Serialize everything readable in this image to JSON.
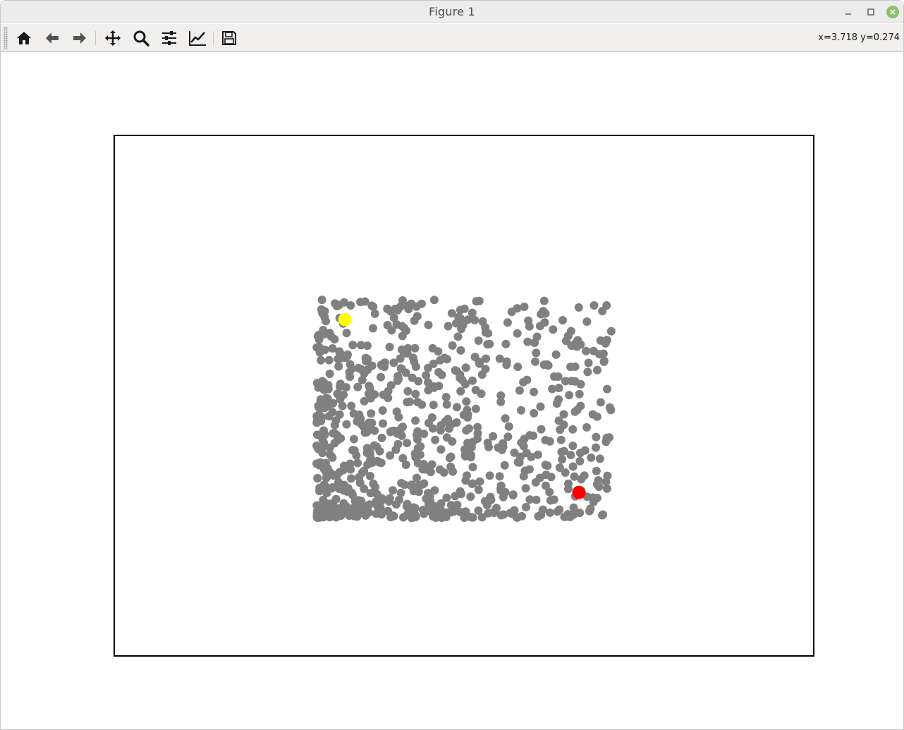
{
  "window": {
    "title": "Figure 1"
  },
  "toolbar": {
    "buttons": [
      {
        "name": "home-button",
        "icon": "home-icon"
      },
      {
        "name": "back-button",
        "icon": "arrow-left-icon"
      },
      {
        "name": "forward-button",
        "icon": "arrow-right-icon"
      },
      {
        "name": "pan-button",
        "icon": "move-icon"
      },
      {
        "name": "zoom-button",
        "icon": "magnifier-icon"
      },
      {
        "name": "configure-subplots-button",
        "icon": "sliders-icon"
      },
      {
        "name": "edit-axes-button",
        "icon": "line-chart-icon"
      },
      {
        "name": "save-button",
        "icon": "floppy-disk-icon"
      }
    ],
    "coords": "x=3.718 y=0.274"
  },
  "colors": {
    "point": "#808080",
    "yellow_marker": "#ffff00",
    "red_marker": "#ff0000",
    "close_button": "#8fbf6f",
    "axes_frame": "#000000"
  },
  "chart_data": {
    "type": "scatter",
    "axes_visible": false,
    "grid": false,
    "title": "",
    "xlabel": "",
    "ylabel": "",
    "xlim": [
      -7.5,
      9.8
    ],
    "ylim": [
      -4.5,
      5.7
    ],
    "cloud": {
      "count": 780,
      "x_range": [
        -2.5,
        4.8
      ],
      "y_range": [
        -1.8,
        2.5
      ],
      "density": "denser toward lower-left, sparser toward upper-right",
      "color": "#808080",
      "seed": 20240517
    },
    "highlights": [
      {
        "label": "",
        "x": -1.8,
        "y": 2.1,
        "color": "#ffff00"
      },
      {
        "label": "",
        "x": 4.0,
        "y": -1.3,
        "color": "#ff0000"
      }
    ]
  }
}
